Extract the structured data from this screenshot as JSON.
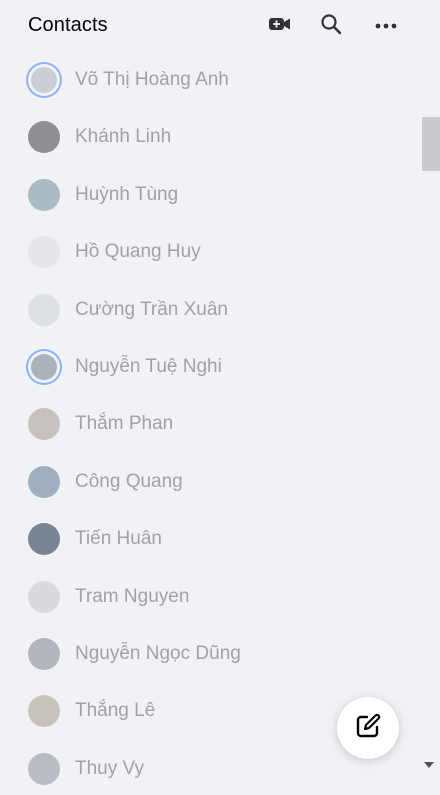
{
  "header": {
    "title": "Contacts",
    "icons": [
      "video-call-icon",
      "search-icon",
      "more-icon"
    ]
  },
  "contacts": [
    {
      "name": "Võ Thị Hoàng Anh",
      "story": true,
      "avatar_color": "#c9ced6"
    },
    {
      "name": "Khánh Linh",
      "story": false,
      "avatar_color": "#8d8f93"
    },
    {
      "name": "Huỳnh Tùng",
      "story": false,
      "avatar_color": "#aabbc5"
    },
    {
      "name": "Hồ Quang Huy",
      "story": false,
      "avatar_color": "#e3e5e8"
    },
    {
      "name": "Cường Trần Xuân",
      "story": false,
      "avatar_color": "#dcdfe3"
    },
    {
      "name": "Nguyễn Tuệ Nghi",
      "story": true,
      "avatar_color": "#a9b3b8"
    },
    {
      "name": "Thắm Phan",
      "story": false,
      "avatar_color": "#c7c2bd"
    },
    {
      "name": "Công Quang",
      "story": false,
      "avatar_color": "#9eb0c0"
    },
    {
      "name": "Tiến Huân",
      "story": false,
      "avatar_color": "#7a8494"
    },
    {
      "name": "Tram Nguyen",
      "story": false,
      "avatar_color": "#d8dadd"
    },
    {
      "name": "Nguyễn Ngọc Dũng",
      "story": false,
      "avatar_color": "#b3b7bd"
    },
    {
      "name": "Thắng Lê",
      "story": false,
      "avatar_color": "#c8c3ba"
    },
    {
      "name": "Thuy Vy",
      "story": false,
      "avatar_color": "#b9bcc2"
    }
  ],
  "fab": {
    "icon": "compose-icon"
  },
  "colors": {
    "background": "#f0f2f5",
    "title": "#050505",
    "contact_text": "#a0a2a7",
    "story_ring": "#8ab4f8"
  }
}
